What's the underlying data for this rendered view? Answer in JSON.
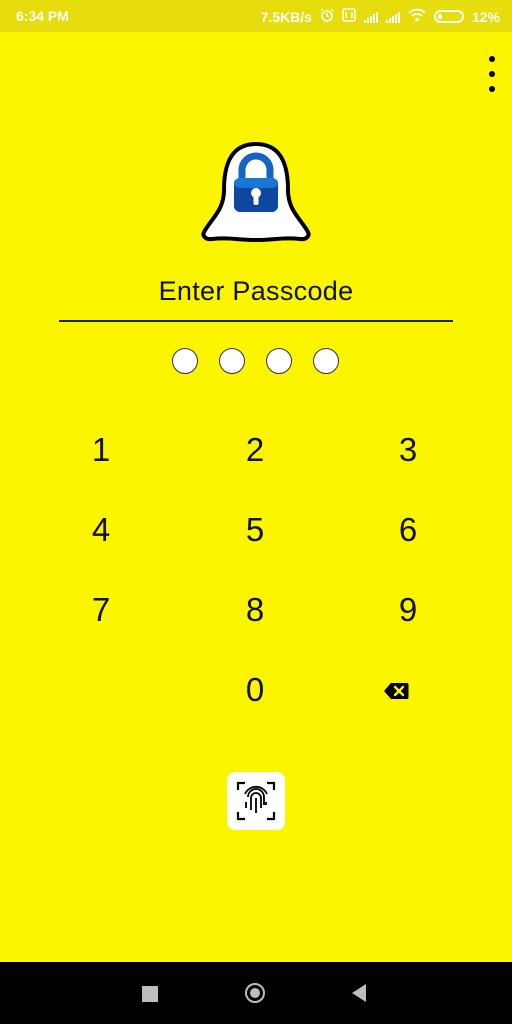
{
  "status_bar": {
    "time": "6:34 PM",
    "network_speed": "7.5KB/s",
    "battery_percent": "12%",
    "icons": [
      "alarm-icon",
      "data-icon",
      "signal-icon",
      "signal-icon",
      "wifi-icon",
      "battery-icon"
    ]
  },
  "header": {
    "menu_icon": "more-vert-icon"
  },
  "lock_screen": {
    "logo_icon": "ghost-lock-icon",
    "title": "Enter Passcode",
    "passcode_length": 4,
    "entered_digits": 0
  },
  "keypad": {
    "keys": [
      "1",
      "2",
      "3",
      "4",
      "5",
      "6",
      "7",
      "8",
      "9",
      "0"
    ],
    "backspace_icon": "backspace-icon",
    "fingerprint_icon": "fingerprint-icon"
  },
  "colors": {
    "background": "#fbf500",
    "status_bar": "#e8dd0c",
    "lock_blue": "#0d47a1",
    "nav_bar": "#000000"
  },
  "navigation_bar": {
    "buttons": [
      "recent-apps-icon",
      "home-icon",
      "back-icon"
    ]
  }
}
